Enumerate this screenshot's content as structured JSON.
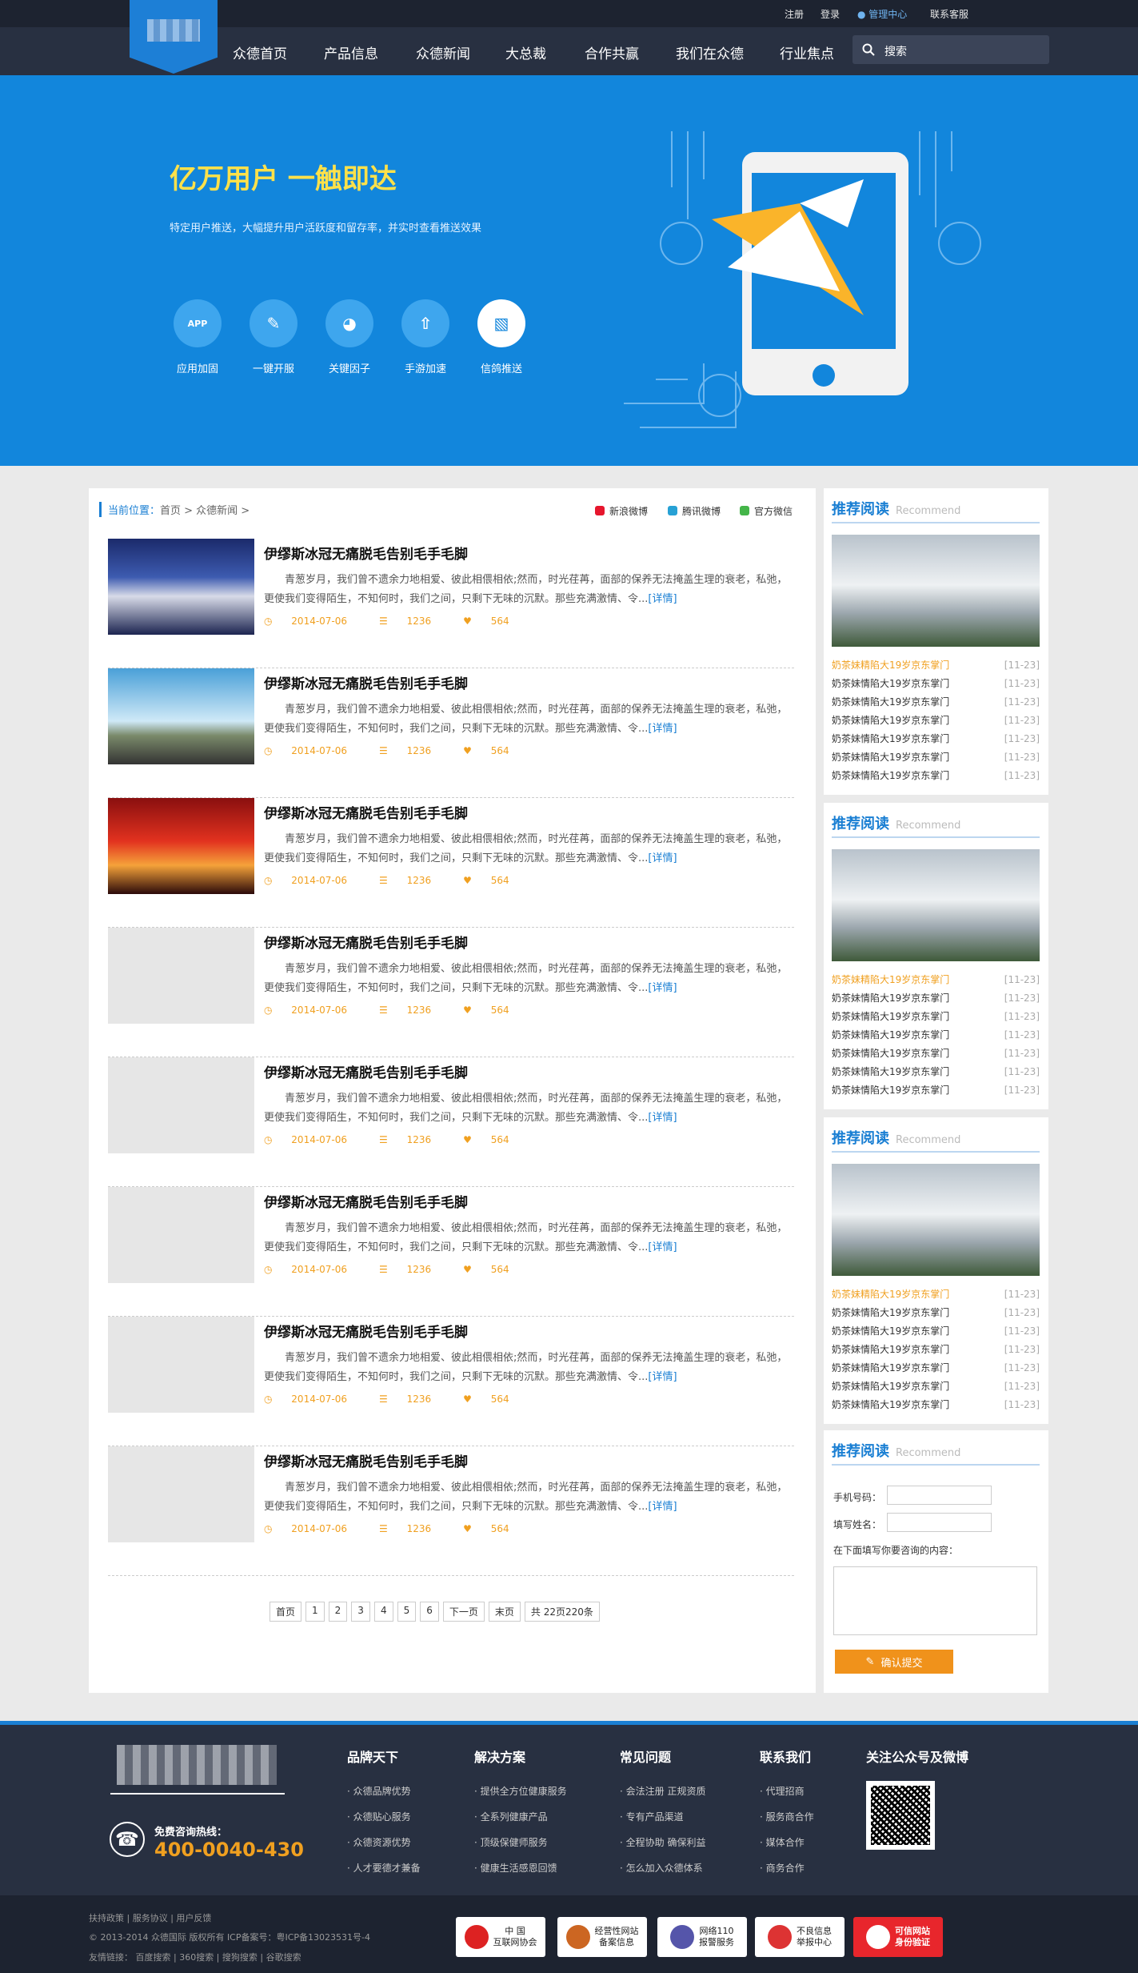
{
  "topbar": {
    "register": "注册",
    "login": "登录",
    "admin": "管理中心",
    "support": "联系客服"
  },
  "nav": {
    "items": [
      "众德首页",
      "产品信息",
      "众德新闻",
      "大总裁",
      "合作共赢",
      "我们在众德",
      "行业焦点"
    ],
    "search_placeholder": "搜索"
  },
  "banner": {
    "title": "亿万用户 一触即达",
    "subtitle": "特定用户推送，大幅提升用户活跃度和留存率，并实时查看推送效果",
    "features": [
      "应用加固",
      "一键开服",
      "关键因子",
      "手游加速",
      "信鸽推送"
    ],
    "feature_icons": [
      "app-icon",
      "user-icon",
      "pie-icon",
      "rocket-icon",
      "push-icon"
    ]
  },
  "breadcrumb": {
    "label": "当前位置：",
    "path": "首页 > 众德新闻 >"
  },
  "share": {
    "weibo": "新浪微博",
    "tencent": "腾讯微博",
    "wechat": "官方微信"
  },
  "articles": [
    {
      "title": "伊缪斯冰冠无痛脱毛告别毛手毛脚",
      "excerpt": "青葱岁月，我们曾不遗余力地相爱、彼此相偎相依;然而，时光荏苒，面部的保养无法掩盖生理的衰老，私弛，更使我们变得陌生，不知何时，我们之间，只剩下无味的沉默。那些充满激情、令...",
      "more": "[详情]",
      "date": "2014-07-06",
      "views": "1236",
      "likes": "564",
      "thumb": "crowd"
    },
    {
      "title": "伊缪斯冰冠无痛脱毛告别毛手毛脚",
      "excerpt": "青葱岁月，我们曾不遗余力地相爱、彼此相偎相依;然而，时光荏苒，面部的保养无法掩盖生理的衰老，私弛，更使我们变得陌生，不知何时，我们之间，只剩下无味的沉默。那些充满激情、令...",
      "more": "[详情]",
      "date": "2014-07-06",
      "views": "1236",
      "likes": "564",
      "thumb": "city"
    },
    {
      "title": "伊缪斯冰冠无痛脱毛告别毛手毛脚",
      "excerpt": "青葱岁月，我们曾不遗余力地相爱、彼此相偎相依;然而，时光荏苒，面部的保养无法掩盖生理的衰老，私弛，更使我们变得陌生，不知何时，我们之间，只剩下无味的沉默。那些充满激情、令...",
      "more": "[详情]",
      "date": "2014-07-06",
      "views": "1236",
      "likes": "564",
      "thumb": "stage"
    },
    {
      "title": "伊缪斯冰冠无痛脱毛告别毛手毛脚",
      "excerpt": "青葱岁月，我们曾不遗余力地相爱、彼此相偎相依;然而，时光荏苒，面部的保养无法掩盖生理的衰老，私弛，更使我们变得陌生，不知何时，我们之间，只剩下无味的沉默。那些充满激情、令...",
      "more": "[详情]",
      "date": "2014-07-06",
      "views": "1236",
      "likes": "564",
      "thumb": "blank"
    },
    {
      "title": "伊缪斯冰冠无痛脱毛告别毛手毛脚",
      "excerpt": "青葱岁月，我们曾不遗余力地相爱、彼此相偎相依;然而，时光荏苒，面部的保养无法掩盖生理的衰老，私弛，更使我们变得陌生，不知何时，我们之间，只剩下无味的沉默。那些充满激情、令...",
      "more": "[详情]",
      "date": "2014-07-06",
      "views": "1236",
      "likes": "564",
      "thumb": "blank"
    },
    {
      "title": "伊缪斯冰冠无痛脱毛告别毛手毛脚",
      "excerpt": "青葱岁月，我们曾不遗余力地相爱、彼此相偎相依;然而，时光荏苒，面部的保养无法掩盖生理的衰老，私弛，更使我们变得陌生，不知何时，我们之间，只剩下无味的沉默。那些充满激情、令...",
      "more": "[详情]",
      "date": "2014-07-06",
      "views": "1236",
      "likes": "564",
      "thumb": "blank"
    },
    {
      "title": "伊缪斯冰冠无痛脱毛告别毛手毛脚",
      "excerpt": "青葱岁月，我们曾不遗余力地相爱、彼此相偎相依;然而，时光荏苒，面部的保养无法掩盖生理的衰老，私弛，更使我们变得陌生，不知何时，我们之间，只剩下无味的沉默。那些充满激情、令...",
      "more": "[详情]",
      "date": "2014-07-06",
      "views": "1236",
      "likes": "564",
      "thumb": "blank"
    },
    {
      "title": "伊缪斯冰冠无痛脱毛告别毛手毛脚",
      "excerpt": "青葱岁月，我们曾不遗余力地相爱、彼此相偎相依;然而，时光荏苒，面部的保养无法掩盖生理的衰老，私弛，更使我们变得陌生，不知何时，我们之间，只剩下无味的沉默。那些充满激情、令...",
      "more": "[详情]",
      "date": "2014-07-06",
      "views": "1236",
      "likes": "564",
      "thumb": "blank"
    }
  ],
  "pager": [
    "首页",
    "1",
    "2",
    "3",
    "4",
    "5",
    "6",
    "下一页",
    "末页",
    "共 22页220条"
  ],
  "sidebar": {
    "title": "推荐阅读",
    "title_en": "Recommend",
    "items": [
      {
        "text": "奶茶妹精陷大19岁京东掌门",
        "date": "[11-23]"
      },
      {
        "text": "奶茶妹情陷大19岁京东掌门",
        "date": "[11-23]"
      },
      {
        "text": "奶茶妹情陷大19岁京东掌门",
        "date": "[11-23]"
      },
      {
        "text": "奶茶妹情陷大19岁京东掌门",
        "date": "[11-23]"
      },
      {
        "text": "奶茶妹情陷大19岁京东掌门",
        "date": "[11-23]"
      },
      {
        "text": "奶茶妹情陷大19岁京东掌门",
        "date": "[11-23]"
      },
      {
        "text": "奶茶妹情陷大19岁京东掌门",
        "date": "[11-23]"
      }
    ],
    "form": {
      "phone_label": "手机号码：",
      "name_label": "填写姓名：",
      "content_label": "在下面填写你要咨询的内容：",
      "submit": "确认提交"
    }
  },
  "footer": {
    "hotline_label": "免费咨询热线：",
    "hotline": "400-0040-430",
    "columns": [
      {
        "title": "品牌天下",
        "links": [
          "· 众德品牌优势",
          "· 众德贴心服务",
          "· 众德资源优势",
          "· 人才要德才兼备"
        ]
      },
      {
        "title": "解决方案",
        "links": [
          "· 提供全方位健康服务",
          "· 全系列健康产品",
          "· 顶级保健师服务",
          "· 健康生活感恩回馈"
        ]
      },
      {
        "title": "常见问题",
        "links": [
          "· 会法注册 正规资质",
          "· 专有产品渠道",
          "· 全程协助 确保利益",
          "· 怎么加入众德体系"
        ]
      },
      {
        "title": "联系我们",
        "links": [
          "· 代理招商",
          "· 服务商合作",
          "· 媒体合作",
          "· 商务合作"
        ]
      }
    ],
    "follow_title": "关注公众号及微博",
    "bottom_links": "扶持政策 | 服务协议 | 用户反馈",
    "copyright": "© 2013-2014 众德国际 版权所有 ICP备案号：粤ICP备13023531号-4",
    "friend_links": "友情链接： 百度搜索 | 360搜索 | 搜狗搜索 | 谷歌搜索",
    "badges": [
      "中 国\n互联网协会",
      "经营性网站\n备案信息",
      "网络110\n报警服务",
      "不良信息\n举报中心",
      "可信网站\n身份验证"
    ]
  },
  "colors": {
    "accent": "#1a7fd3",
    "banner": "#1286dc",
    "orange": "#f0921b",
    "dark": "#283041"
  }
}
